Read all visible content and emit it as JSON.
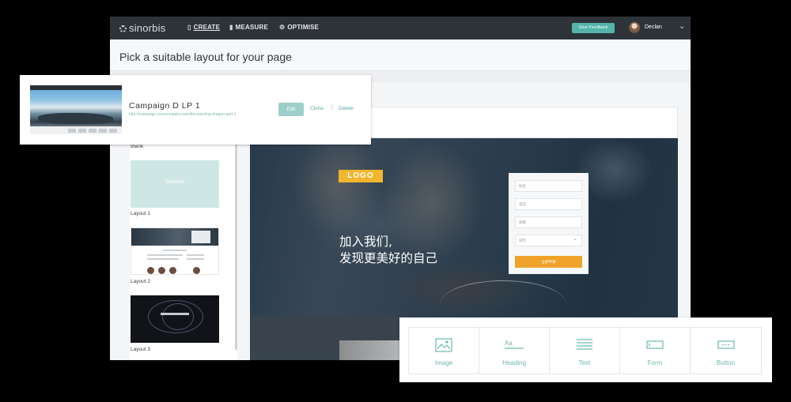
{
  "app": {
    "brand": "sinorbis",
    "nav": [
      {
        "label": "CREATE",
        "icon": "create-icon",
        "active": true
      },
      {
        "label": "MEASURE",
        "icon": "measure-icon",
        "active": false
      },
      {
        "label": "OPTIMISE",
        "icon": "optimise-icon",
        "active": false
      }
    ],
    "feedback_label": "Give Feedback",
    "user_name": "Declan",
    "page_title": "Pick a suitable layout for your page"
  },
  "layouts": [
    {
      "label": "Blank",
      "thumb_text": "Selected"
    },
    {
      "label": "Layout 1"
    },
    {
      "label": "Layout 2"
    },
    {
      "label": "Layout 3"
    }
  ],
  "preview": {
    "logo": "LOGO",
    "headline_line1": "加入我们,",
    "headline_line2": "发现更美好的自己",
    "form_fields": [
      "姓名",
      "电话",
      "邮箱",
      "城市"
    ],
    "submit_label": "立即申请"
  },
  "campaign_card": {
    "title": "Campaign D LP 1",
    "url": "http://campaign.yourcompany.com/the-warning-dragon-part-1",
    "edit_label": "Edit",
    "clone_label": "Clone",
    "separator": "|",
    "delete_label": "Delete"
  },
  "widgets": [
    {
      "label": "Image",
      "icon": "image-icon"
    },
    {
      "label": "Heading",
      "icon": "heading-icon"
    },
    {
      "label": "Text",
      "icon": "text-icon"
    },
    {
      "label": "Form",
      "icon": "form-icon"
    },
    {
      "label": "Button",
      "icon": "button-icon"
    }
  ],
  "colors": {
    "topbar": "#2e333a",
    "accent": "#52b4aa",
    "logo": "#f0b62e",
    "cta": "#f0a32a"
  }
}
